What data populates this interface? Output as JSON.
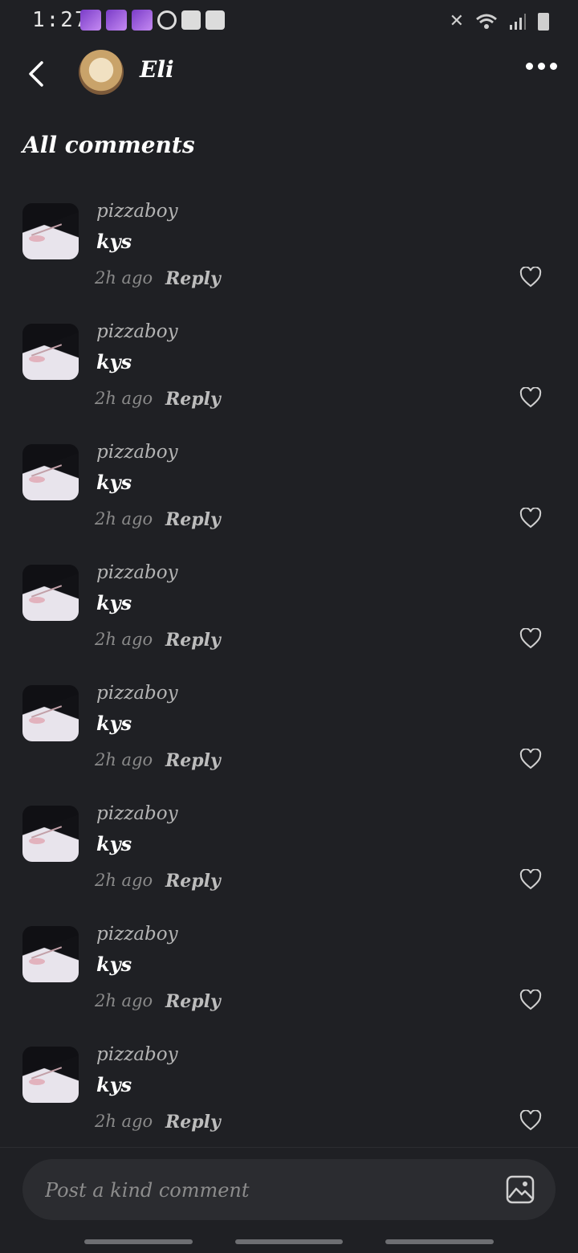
{
  "status_bar": {
    "time": "1:27"
  },
  "header": {
    "title": "Eli"
  },
  "section": {
    "title": "All comments"
  },
  "comments": [
    {
      "user": "pizzaboy",
      "text": "kys",
      "time": "2h ago",
      "reply_label": "Reply"
    },
    {
      "user": "pizzaboy",
      "text": "kys",
      "time": "2h ago",
      "reply_label": "Reply"
    },
    {
      "user": "pizzaboy",
      "text": "kys",
      "time": "2h ago",
      "reply_label": "Reply"
    },
    {
      "user": "pizzaboy",
      "text": "kys",
      "time": "2h ago",
      "reply_label": "Reply"
    },
    {
      "user": "pizzaboy",
      "text": "kys",
      "time": "2h ago",
      "reply_label": "Reply"
    },
    {
      "user": "pizzaboy",
      "text": "kys",
      "time": "2h ago",
      "reply_label": "Reply"
    },
    {
      "user": "pizzaboy",
      "text": "kys",
      "time": "2h ago",
      "reply_label": "Reply"
    },
    {
      "user": "pizzaboy",
      "text": "kys",
      "time": "2h ago",
      "reply_label": "Reply"
    }
  ],
  "composer": {
    "placeholder": "Post a kind comment"
  },
  "icons": {
    "back": "chevron-left-icon",
    "more": "more-horizontal-icon",
    "like": "heart-icon",
    "attach": "image-icon"
  },
  "colors": {
    "background": "#1f2024",
    "input": "#2b2c30",
    "muted": "#8a8a8a"
  }
}
